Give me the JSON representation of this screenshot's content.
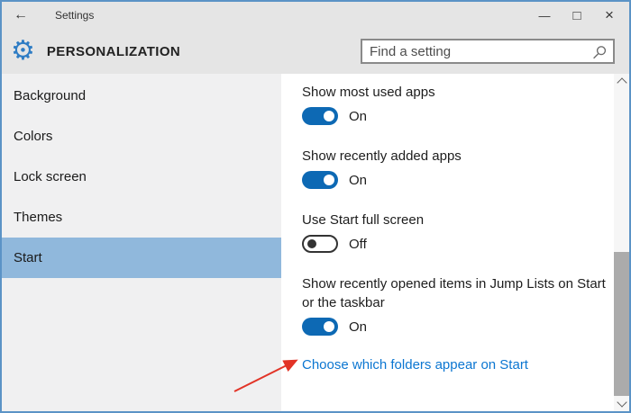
{
  "window": {
    "title": "Settings"
  },
  "icons": {
    "back": "←",
    "minimize": "—",
    "maximize": "□",
    "close": "×",
    "gear": "⚙"
  },
  "header": {
    "title": "PERSONALIZATION",
    "search": {
      "placeholder": "Find a setting"
    }
  },
  "sidebar": {
    "items": [
      {
        "label": "Background",
        "selected": false
      },
      {
        "label": "Colors",
        "selected": false
      },
      {
        "label": "Lock screen",
        "selected": false
      },
      {
        "label": "Themes",
        "selected": false
      },
      {
        "label": "Start",
        "selected": true
      }
    ]
  },
  "main": {
    "settings": [
      {
        "label": "Show most used apps",
        "state": "On"
      },
      {
        "label": "Show recently added apps",
        "state": "On"
      },
      {
        "label": "Use Start full screen",
        "state": "Off"
      },
      {
        "label": "Show recently opened items in Jump Lists on Start or the taskbar",
        "state": "On"
      }
    ],
    "link": "Choose which folders appear on Start"
  },
  "colors": {
    "accent_toggle": "#0d69b4",
    "sidebar_selected": "#90b8dc",
    "link": "#0b76d1",
    "window_border": "#5b93c6",
    "titlebar_background": "#e5e5e5",
    "sidebar_background": "#f0f0f1",
    "annotation_arrow": "#e23326"
  },
  "annotation": {
    "type": "red-arrow"
  }
}
